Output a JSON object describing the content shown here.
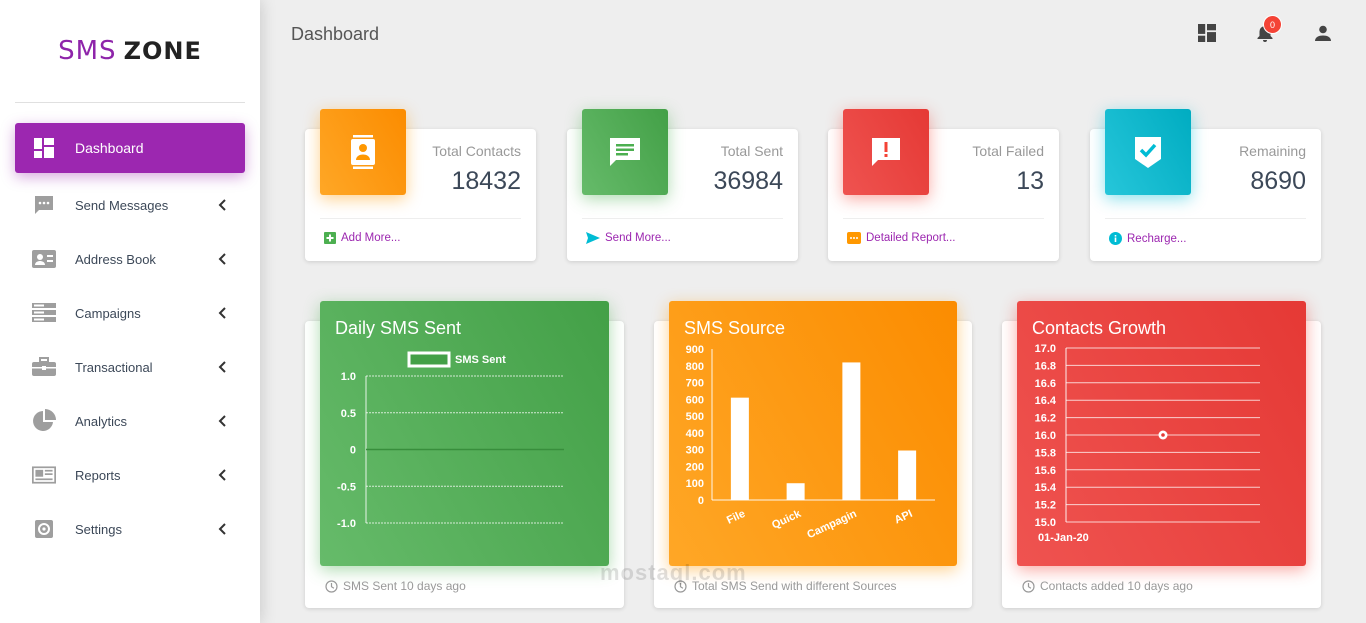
{
  "brand": {
    "part1": "SMS",
    "part2": "ZONE"
  },
  "sidebar": {
    "items": [
      {
        "label": "Dashboard",
        "icon": "dashboard-icon",
        "active": true
      },
      {
        "label": "Send Messages",
        "icon": "message-icon"
      },
      {
        "label": "Address Book",
        "icon": "contact-card-icon"
      },
      {
        "label": "Campaigns",
        "icon": "campaigns-icon"
      },
      {
        "label": "Transactional",
        "icon": "briefcase-icon"
      },
      {
        "label": "Analytics",
        "icon": "pie-chart-icon"
      },
      {
        "label": "Reports",
        "icon": "newspaper-icon"
      },
      {
        "label": "Settings",
        "icon": "gear-icon"
      }
    ]
  },
  "header": {
    "title": "Dashboard",
    "notification_count": "0"
  },
  "stats": [
    {
      "title": "Total Contacts",
      "value": "18432",
      "footer": "Add More...",
      "icon": "contact-book-icon",
      "color": "#ff9800"
    },
    {
      "title": "Total Sent",
      "value": "36984",
      "footer": "Send More...",
      "icon": "chat-icon",
      "color": "#4caf50"
    },
    {
      "title": "Total Failed",
      "value": "13",
      "footer": "Detailed Report...",
      "icon": "alert-message-icon",
      "color": "#f44336"
    },
    {
      "title": "Remaining",
      "value": "8690",
      "footer": "Recharge...",
      "icon": "verified-icon",
      "color": "#00bcd4"
    }
  ],
  "charts": [
    {
      "title": "Daily SMS Sent",
      "footer": "SMS Sent 10 days ago"
    },
    {
      "title": "SMS Source",
      "footer": "Total SMS Send with different Sources"
    },
    {
      "title": "Contacts Growth",
      "footer": "Contacts added 10 days ago"
    }
  ],
  "chart_data": [
    {
      "type": "line",
      "title": "Daily SMS Sent",
      "legend": [
        "SMS Sent"
      ],
      "series": [
        {
          "name": "SMS Sent",
          "values": [
            0
          ]
        }
      ],
      "ylim": [
        -1.0,
        1.0
      ],
      "yticks": [
        "1.0",
        "0.5",
        "0",
        "-0.5",
        "-1.0"
      ],
      "grid": true
    },
    {
      "type": "bar",
      "title": "SMS Source",
      "categories": [
        "File",
        "Quick",
        "Campagin",
        "API"
      ],
      "values": [
        610,
        100,
        820,
        295
      ],
      "ylim": [
        0,
        900
      ],
      "yticks": [
        "900",
        "800",
        "700",
        "600",
        "500",
        "400",
        "300",
        "200",
        "100",
        "0"
      ],
      "grid": false
    },
    {
      "type": "scatter",
      "title": "Contacts Growth",
      "x": [
        "01-Jan-20"
      ],
      "values": [
        16.0
      ],
      "ylim": [
        15.0,
        17.0
      ],
      "yticks": [
        "17.0",
        "16.8",
        "16.6",
        "16.4",
        "16.2",
        "16.0",
        "15.8",
        "15.6",
        "15.4",
        "15.2",
        "15.0"
      ],
      "grid": true
    }
  ],
  "watermark": "mostaql.com"
}
